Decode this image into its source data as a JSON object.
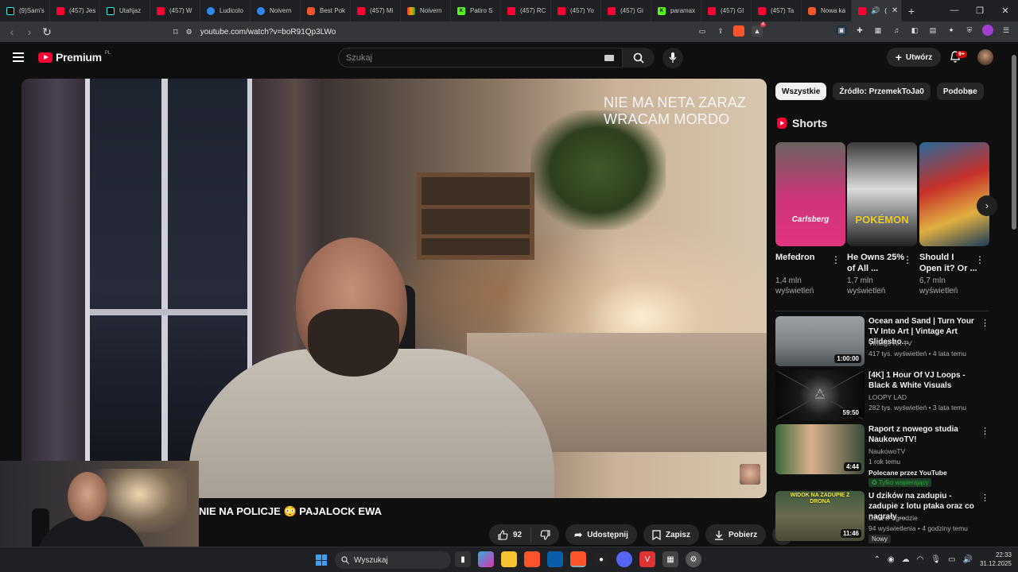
{
  "browser": {
    "tabs": [
      {
        "label": "(9)Sam's",
        "icon": "tiktok"
      },
      {
        "label": "(457) Jes",
        "icon": "youtube"
      },
      {
        "label": "Utahjaz",
        "icon": "tiktok"
      },
      {
        "label": "(457) W",
        "icon": "youtube"
      },
      {
        "label": "Ludicolo",
        "icon": "cloudflare"
      },
      {
        "label": "Noivern",
        "icon": "cloudflare"
      },
      {
        "label": "Best Pok",
        "icon": "music"
      },
      {
        "label": "(457) Mi",
        "icon": "youtube"
      },
      {
        "label": "Noivern",
        "icon": "multicolor"
      },
      {
        "label": "Patiro S",
        "icon": "kick"
      },
      {
        "label": "(457) RC",
        "icon": "youtube"
      },
      {
        "label": "(457) Yo",
        "icon": "youtube"
      },
      {
        "label": "(457) Gi",
        "icon": "youtube"
      },
      {
        "label": "paramax",
        "icon": "kick"
      },
      {
        "label": "(457) GI",
        "icon": "youtube"
      },
      {
        "label": "(457) Ta",
        "icon": "youtube"
      },
      {
        "label": "Nowa ka",
        "icon": "brave"
      },
      {
        "label": "(",
        "icon": "youtube",
        "active": true
      }
    ],
    "url": "youtube.com/watch?v=boR91Qp3LWo",
    "brave_badge": "4"
  },
  "youtube": {
    "logo_text": "Premium",
    "country_code": "PL",
    "search_placeholder": "Szukaj",
    "create_label": "Utwórz",
    "notifications_badge": "9+"
  },
  "video": {
    "overlay_line1": "NIE MA NETA ZARAZ",
    "overlay_line2": "WRACAM MORDO",
    "title": "NIE NA POLICJE",
    "title_emoji": "😳",
    "title_suffix": "PAJALOCK EWA",
    "likes": "92",
    "share_label": "Udostępnij",
    "save_label": "Zapisz",
    "download_label": "Pobierz"
  },
  "sidebar": {
    "chips": [
      "Wszystkie",
      "Źródło: PrzemekToJa0",
      "Podobne"
    ],
    "shorts_header": "Shorts",
    "shorts": [
      {
        "title": "Mefedron",
        "views": "1,4 mln wyświetleń",
        "thumb_text": "Carlsberg"
      },
      {
        "title": "He Owns 25% of All ...",
        "views": "1,7 mln wyświetleń",
        "thumb_text": "POKÉMON"
      },
      {
        "title": "Should I Open it? Or ...",
        "views": "6,7 mln wyświetleń",
        "thumb_text": ""
      }
    ],
    "recommendations": [
      {
        "title": "Ocean and Sand | Turn Your TV Into Art | Vintage Art Slidesho...",
        "channel": "Vintage Art TV",
        "meta": "417 tys. wyświetleń • 4 lata temu",
        "duration": "1:00:00"
      },
      {
        "title": "[4K] 1 Hour Of VJ Loops - Black & White Visuals",
        "channel": "LOOPY LAD",
        "meta": "282 tys. wyświetleń • 3 lata temu",
        "duration": "59:50"
      },
      {
        "title": "Raport z nowego studia NaukowoTV!",
        "channel": "NaukowoTV",
        "meta": "1 rok temu",
        "promo": "Polecane przez YouTube",
        "members": "Tylko wspierający",
        "duration": "4:44"
      },
      {
        "title": "U dzików na zadupiu - zadupie z lotu ptaka oraz co nagrały ...",
        "channel": "Dziki w ogrodzie",
        "meta": "94 wyświetlenia • 4 godziny temu",
        "badge": "Nowy",
        "duration": "11:46",
        "thumb_text": "WIDOK NA ZADUPIE Z DRONA"
      }
    ]
  },
  "taskbar": {
    "search_placeholder": "Wyszukaj",
    "time": "22:33",
    "date": "31.12.2025"
  },
  "colors": {
    "accent_red": "#ff0033",
    "bg": "#0f0f0f",
    "chip_bg": "#272727"
  }
}
